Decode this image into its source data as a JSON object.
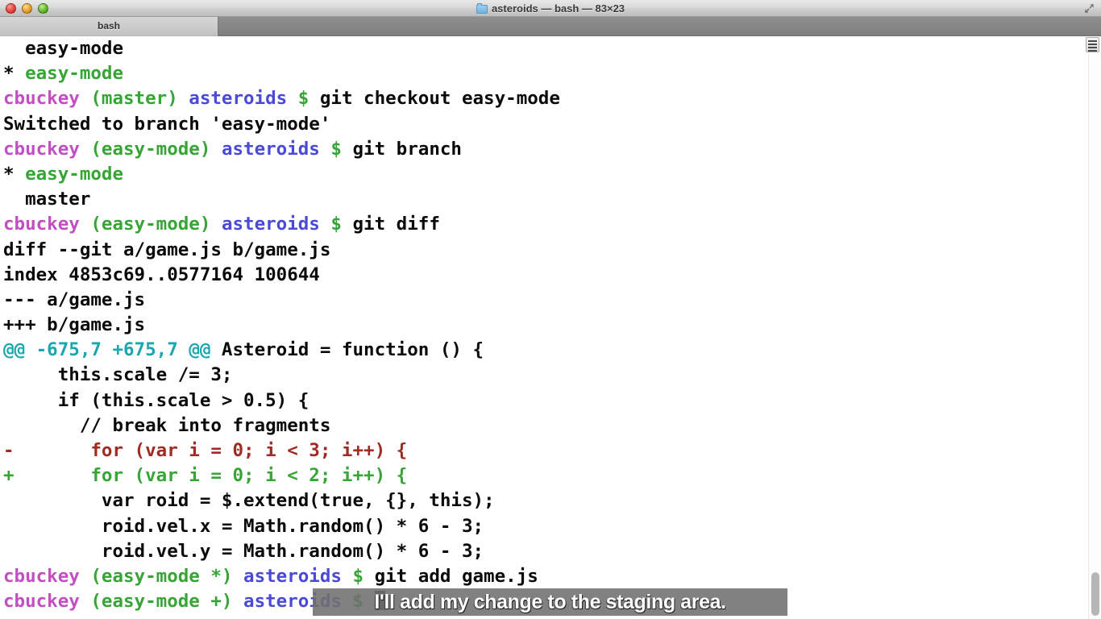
{
  "window": {
    "title": "asteroids — bash — 83×23",
    "folder_icon": "folder-icon",
    "fullscreen_icon": "fullscreen-arrows-icon",
    "traffic_lights": {
      "close": "close-button",
      "minimize": "minimize-button",
      "maximize": "maximize-button"
    },
    "colors": {
      "titlebar_top": "#e8e8e8",
      "titlebar_bottom": "#bdbdbd",
      "tabbar": "#7e7e7e",
      "terminal_background": "#ffffff",
      "magenta": "#c14fc1",
      "green": "#36a536",
      "blue": "#4a4ad6",
      "red": "#9e2b24",
      "cyan": "#1aa7ae",
      "caption_background": "#707070"
    }
  },
  "tabs": [
    {
      "label": "bash",
      "active": true
    }
  ],
  "terminal": {
    "rows": [
      {
        "id": "row-0",
        "segments": [
          {
            "text": "  easy-mode",
            "color": "black"
          }
        ]
      },
      {
        "id": "row-1",
        "segments": [
          {
            "text": "* ",
            "color": "black"
          },
          {
            "text": "easy-mode",
            "color": "green"
          }
        ]
      },
      {
        "id": "row-2",
        "segments": [
          {
            "text": "cbuckey ",
            "color": "magenta"
          },
          {
            "text": "(master)",
            "color": "green"
          },
          {
            "text": " ",
            "color": "black"
          },
          {
            "text": "asteroids",
            "color": "blue"
          },
          {
            "text": " ",
            "color": "black"
          },
          {
            "text": "$",
            "color": "green"
          },
          {
            "text": " git checkout easy-mode",
            "color": "black"
          }
        ]
      },
      {
        "id": "row-3",
        "segments": [
          {
            "text": "Switched to branch 'easy-mode'",
            "color": "black"
          }
        ]
      },
      {
        "id": "row-4",
        "segments": [
          {
            "text": "cbuckey ",
            "color": "magenta"
          },
          {
            "text": "(easy-mode)",
            "color": "green"
          },
          {
            "text": " ",
            "color": "black"
          },
          {
            "text": "asteroids",
            "color": "blue"
          },
          {
            "text": " ",
            "color": "black"
          },
          {
            "text": "$",
            "color": "green"
          },
          {
            "text": " git branch",
            "color": "black"
          }
        ]
      },
      {
        "id": "row-5",
        "segments": [
          {
            "text": "* ",
            "color": "black"
          },
          {
            "text": "easy-mode",
            "color": "green"
          }
        ]
      },
      {
        "id": "row-6",
        "segments": [
          {
            "text": "  master",
            "color": "black"
          }
        ]
      },
      {
        "id": "row-7",
        "segments": [
          {
            "text": "cbuckey ",
            "color": "magenta"
          },
          {
            "text": "(easy-mode)",
            "color": "green"
          },
          {
            "text": " ",
            "color": "black"
          },
          {
            "text": "asteroids",
            "color": "blue"
          },
          {
            "text": " ",
            "color": "black"
          },
          {
            "text": "$",
            "color": "green"
          },
          {
            "text": " git diff",
            "color": "black"
          }
        ]
      },
      {
        "id": "row-8",
        "segments": [
          {
            "text": "diff --git a/game.js b/game.js",
            "color": "black"
          }
        ]
      },
      {
        "id": "row-9",
        "segments": [
          {
            "text": "index 4853c69..0577164 100644",
            "color": "black"
          }
        ]
      },
      {
        "id": "row-10",
        "segments": [
          {
            "text": "--- a/game.js",
            "color": "black"
          }
        ]
      },
      {
        "id": "row-11",
        "segments": [
          {
            "text": "+++ b/game.js",
            "color": "black"
          }
        ]
      },
      {
        "id": "row-12",
        "segments": [
          {
            "text": "@@ -675,7 +675,7 @@",
            "color": "cyan"
          },
          {
            "text": " Asteroid = function () {",
            "color": "black"
          }
        ]
      },
      {
        "id": "row-13",
        "segments": [
          {
            "text": "     this.scale /= 3;",
            "color": "black"
          }
        ]
      },
      {
        "id": "row-14",
        "segments": [
          {
            "text": "     if (this.scale > 0.5) {",
            "color": "black"
          }
        ]
      },
      {
        "id": "row-15",
        "segments": [
          {
            "text": "       // break into fragments",
            "color": "black"
          }
        ]
      },
      {
        "id": "row-16",
        "segments": [
          {
            "text": "-       for (var i = 0; i < 3; i++) {",
            "color": "red"
          }
        ]
      },
      {
        "id": "row-17",
        "segments": [
          {
            "text": "+       for (var i = 0; i < 2; i++) {",
            "color": "green"
          }
        ]
      },
      {
        "id": "row-18",
        "segments": [
          {
            "text": "         var roid = $.extend(true, {}, this);",
            "color": "black"
          }
        ]
      },
      {
        "id": "row-19",
        "segments": [
          {
            "text": "         roid.vel.x = Math.random() * 6 - 3;",
            "color": "black"
          }
        ]
      },
      {
        "id": "row-20",
        "segments": [
          {
            "text": "         roid.vel.y = Math.random() * 6 - 3;",
            "color": "black"
          }
        ]
      },
      {
        "id": "row-21",
        "segments": [
          {
            "text": "cbuckey ",
            "color": "magenta"
          },
          {
            "text": "(easy-mode *)",
            "color": "green"
          },
          {
            "text": " ",
            "color": "black"
          },
          {
            "text": "asteroids",
            "color": "blue"
          },
          {
            "text": " ",
            "color": "black"
          },
          {
            "text": "$",
            "color": "green"
          },
          {
            "text": " git add game.js",
            "color": "black"
          }
        ]
      },
      {
        "id": "row-22",
        "segments": [
          {
            "text": "cbuckey ",
            "color": "magenta"
          },
          {
            "text": "(easy-mode +)",
            "color": "green"
          },
          {
            "text": " ",
            "color": "black"
          },
          {
            "text": "asteroids",
            "color": "blue"
          },
          {
            "text": " ",
            "color": "black"
          },
          {
            "text": "$",
            "color": "green"
          },
          {
            "text": " ",
            "color": "black"
          },
          {
            "text": "",
            "cursor": true
          }
        ]
      }
    ],
    "scrollbar": {
      "name": "vertical-scrollbar",
      "thumb_position": "bottom"
    },
    "corner_icon": "terminal-settings-icon"
  },
  "caption": {
    "text": "I'll add my change to the staging area."
  }
}
